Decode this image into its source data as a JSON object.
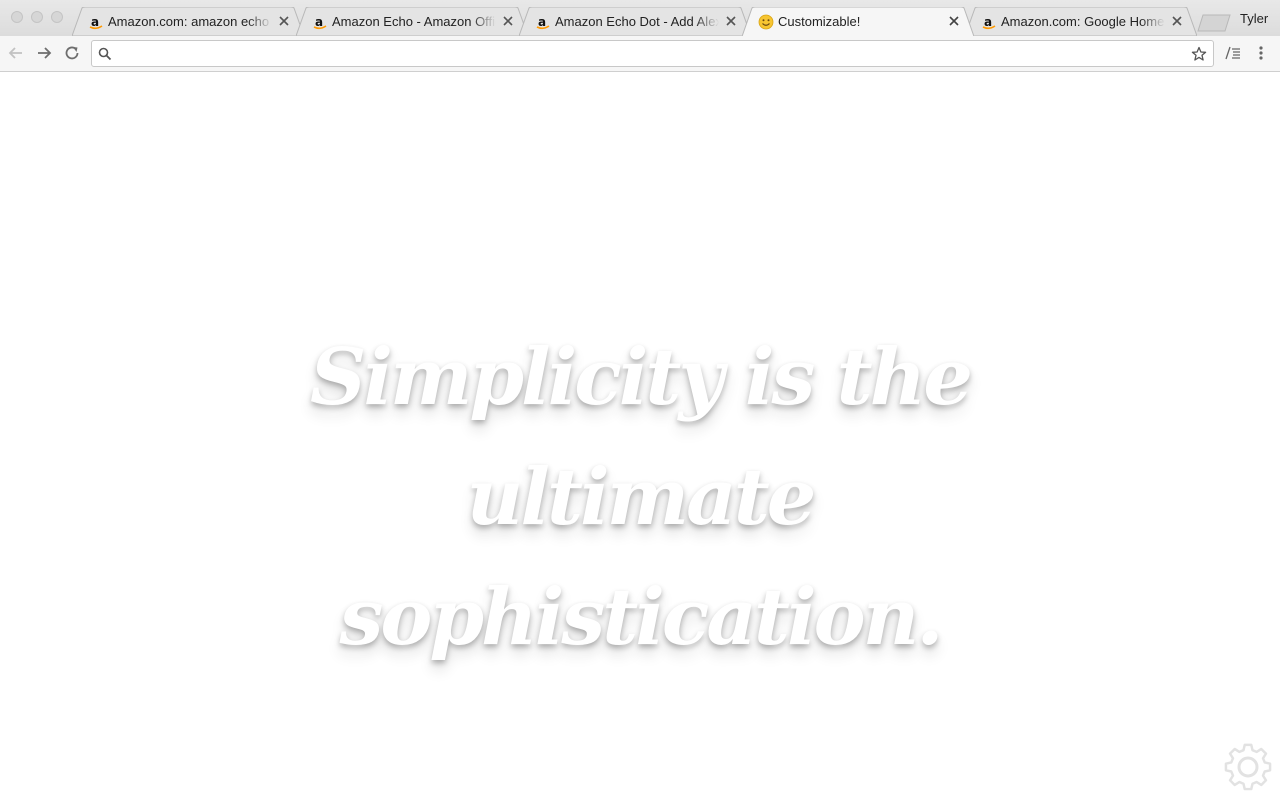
{
  "browser": {
    "tabs": [
      {
        "title": "Amazon.com: amazon echo",
        "favicon": "amazon-icon",
        "active": false
      },
      {
        "title": "Amazon Echo - Amazon Official Site",
        "favicon": "amazon-icon",
        "active": false
      },
      {
        "title": "Amazon Echo Dot - Add Alexa",
        "favicon": "amazon-icon",
        "active": false
      },
      {
        "title": "Customizable!",
        "favicon": "smiley-icon",
        "active": true
      },
      {
        "title": "Amazon.com: Google Home: Google",
        "favicon": "amazon-icon",
        "active": false
      }
    ],
    "profile_name": "Tyler",
    "omnibox": {
      "value": "",
      "placeholder": ""
    }
  },
  "page": {
    "quote": "Simplicity is the ultimate sophistication."
  },
  "colors": {
    "tabstrip": "#dcdcdc",
    "active_tab": "#f6f6f6",
    "page_background": "#ffffff",
    "quote_text": "#ffffff"
  }
}
